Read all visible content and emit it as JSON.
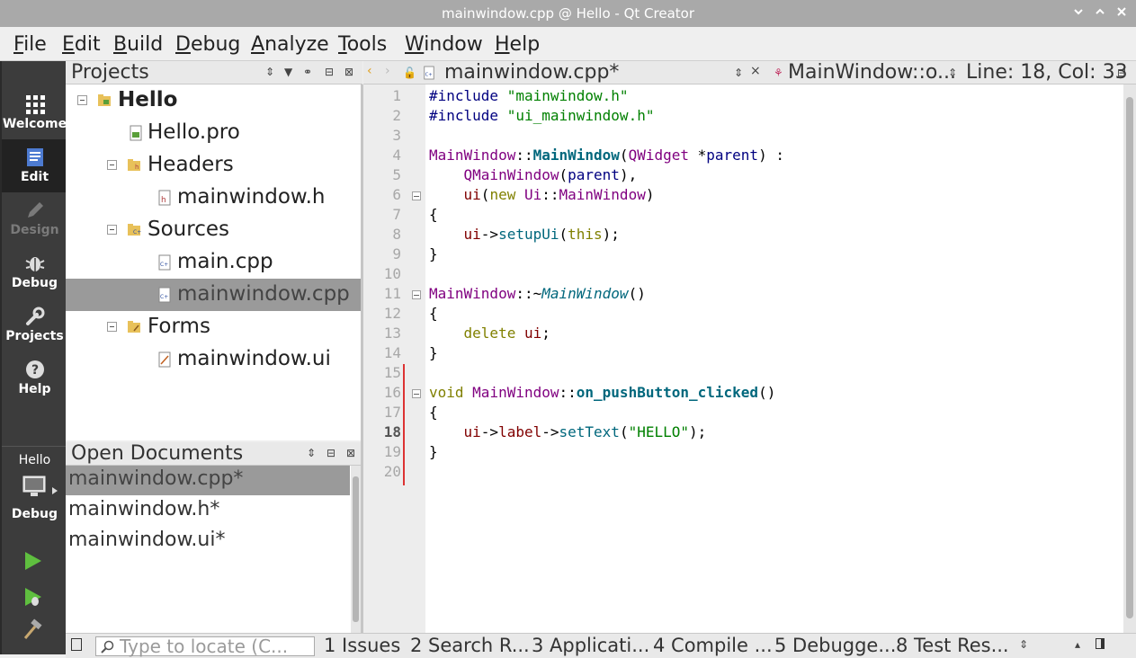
{
  "window": {
    "title": "mainwindow.cpp @ Hello - Qt Creator",
    "controls": [
      "chevron-down",
      "chevron-up",
      "close"
    ]
  },
  "menubar": {
    "items": [
      {
        "label": "File",
        "u": "F",
        "rest": "ile"
      },
      {
        "label": "Edit",
        "u": "E",
        "rest": "dit"
      },
      {
        "label": "Build",
        "u": "B",
        "rest": "uild"
      },
      {
        "label": "Debug",
        "u": "D",
        "rest": "ebug"
      },
      {
        "label": "Analyze",
        "u": "A",
        "rest": "nalyze"
      },
      {
        "label": "Tools",
        "u": "T",
        "rest": "ools"
      },
      {
        "label": "Window",
        "u": "W",
        "rest": "indow"
      },
      {
        "label": "Help",
        "u": "H",
        "rest": "elp"
      }
    ]
  },
  "modes": {
    "welcome": "Welcome",
    "edit": "Edit",
    "design": "Design",
    "debug": "Debug",
    "projects": "Projects",
    "help": "Help",
    "active": "Edit"
  },
  "kit": {
    "project": "Hello",
    "config": "Debug"
  },
  "projects_pane": {
    "title": "Projects",
    "tree": {
      "root": "Hello",
      "pro": "Hello.pro",
      "headers": "Headers",
      "header_file": "mainwindow.h",
      "sources": "Sources",
      "source_main": "main.cpp",
      "source_mainwindow": "mainwindow.cpp",
      "forms": "Forms",
      "form_file": "mainwindow.ui"
    },
    "selected": "mainwindow.cpp"
  },
  "open_documents": {
    "title": "Open Documents",
    "docs": [
      "mainwindow.cpp*",
      "mainwindow.h*",
      "mainwindow.ui*"
    ],
    "selected": "mainwindow.cpp*"
  },
  "editor_toolbar": {
    "file": "mainwindow.cpp*",
    "symbol": "MainWindow::o...",
    "position": "Line: 18, Col: 33"
  },
  "editor": {
    "current_line": 18,
    "line_numbers": [
      "1",
      "2",
      "3",
      "4",
      "5",
      "6",
      "7",
      "8",
      "9",
      "10",
      "11",
      "12",
      "13",
      "14",
      "15",
      "16",
      "17",
      "18",
      "19",
      "20"
    ]
  },
  "statusbar": {
    "locator_placeholder": "Type to locate (C...",
    "tabs": [
      "1 Issues",
      "2 Search R...",
      "3 Applicati...",
      "4 Compile ...",
      "5 Debugge...",
      "8 Test Res..."
    ]
  },
  "colors": {
    "mode_bar": "#3c3c3c",
    "selection": "#9a9a9a",
    "change_marker": "#dd3333",
    "title_bar": "#a9a9a9"
  }
}
